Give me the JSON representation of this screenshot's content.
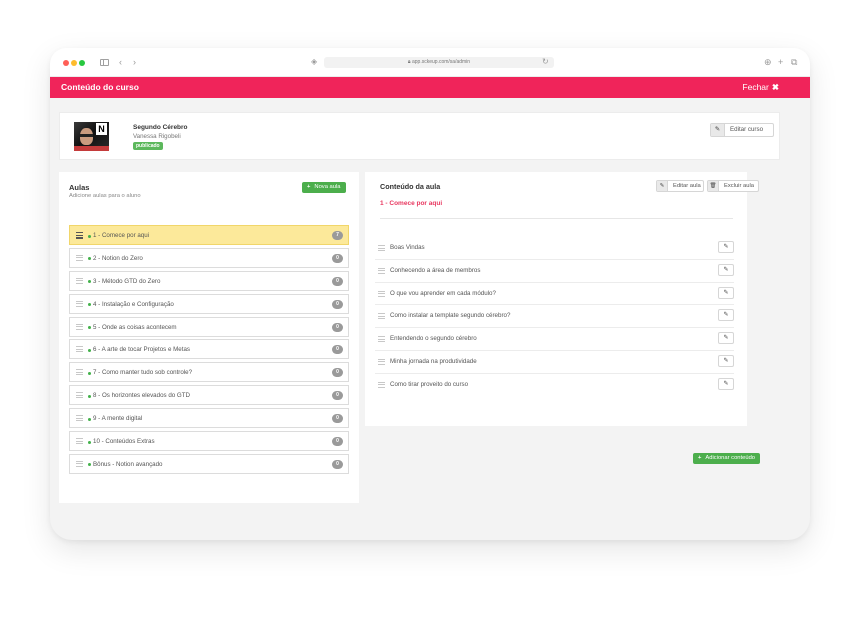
{
  "browser": {
    "url": "app.sckeup.com/sa/admin"
  },
  "topbar": {
    "title": "Conteúdo do curso",
    "close_label": "Fechar",
    "close_icon": "✖"
  },
  "course": {
    "name": "Segundo Cérebro",
    "author": "Vanessa Rigobeli",
    "status": "publicado",
    "edit_label": "Editar curso"
  },
  "lessons_panel": {
    "title": "Aulas",
    "subtitle": "Adicione aulas para o aluno",
    "new_lesson_label": "Nova aula",
    "items": [
      {
        "name": "1 - Comece por aqui",
        "count": "7"
      },
      {
        "name": "2 - Notion do Zero",
        "count": "0"
      },
      {
        "name": "3 - Método GTD do Zero",
        "count": "0"
      },
      {
        "name": "4 - Instalação e Configuração",
        "count": "0"
      },
      {
        "name": "5 - Onde as coisas acontecem",
        "count": "0"
      },
      {
        "name": "6 - A arte de tocar Projetos e Metas",
        "count": "0"
      },
      {
        "name": "7 - Como manter tudo sob controle?",
        "count": "0"
      },
      {
        "name": "8 - Os horizontes elevados do GTD",
        "count": "0"
      },
      {
        "name": "9 - A mente digital",
        "count": "0"
      },
      {
        "name": "10 - Conteúdos Extras",
        "count": "0"
      },
      {
        "name": "Bônus - Notion avançado",
        "count": "0"
      }
    ]
  },
  "content_panel": {
    "title": "Conteúdo da aula",
    "lesson_name": "1 - Comece por aqui",
    "edit_label": "Editar aula",
    "delete_label": "Excluir aula",
    "add_label": "Adicionar conteúdo",
    "items": [
      {
        "name": "Boas Vindas"
      },
      {
        "name": "Conhecendo a área de membros"
      },
      {
        "name": "O que vou aprender em cada módulo?"
      },
      {
        "name": "Como instalar a template segundo cérebro?"
      },
      {
        "name": "Entendendo o segundo cérebro"
      },
      {
        "name": "Minha jornada na produtividade"
      },
      {
        "name": "Como tirar proveito do curso"
      }
    ]
  },
  "colors": {
    "accent": "#f0245a",
    "success": "#4cae4c",
    "active_row": "#fce99a"
  }
}
